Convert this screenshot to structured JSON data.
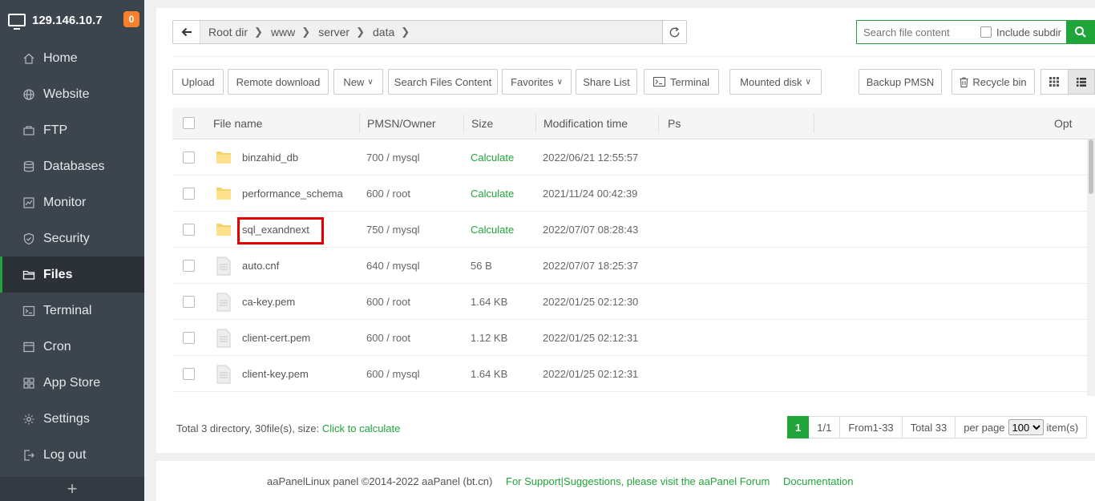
{
  "sidebar": {
    "server_ip": "129.146.10.7",
    "notification_count": "0",
    "items": [
      {
        "label": "Home",
        "icon": "home-icon"
      },
      {
        "label": "Website",
        "icon": "globe-icon"
      },
      {
        "label": "FTP",
        "icon": "ftp-icon"
      },
      {
        "label": "Databases",
        "icon": "database-icon"
      },
      {
        "label": "Monitor",
        "icon": "monitor-icon"
      },
      {
        "label": "Security",
        "icon": "shield-icon"
      },
      {
        "label": "Files",
        "icon": "folder-icon",
        "active": true
      },
      {
        "label": "Terminal",
        "icon": "terminal-icon"
      },
      {
        "label": "Cron",
        "icon": "clock-icon"
      },
      {
        "label": "App Store",
        "icon": "grid-icon"
      },
      {
        "label": "Settings",
        "icon": "gear-icon"
      },
      {
        "label": "Log out",
        "icon": "logout-icon"
      }
    ],
    "add_label": "+"
  },
  "path": {
    "crumbs": [
      "Root dir",
      "www",
      "server",
      "data"
    ]
  },
  "search": {
    "placeholder": "Search file content",
    "include_subdir_label": "Include subdir"
  },
  "toolbar": {
    "upload": "Upload",
    "remote_download": "Remote download",
    "new": "New",
    "search_files_content": "Search Files Content",
    "favorites": "Favorites",
    "share_list": "Share List",
    "terminal": "Terminal",
    "mounted_disk": "Mounted disk",
    "backup_pmsn": "Backup PMSN",
    "recycle_bin": "Recycle bin"
  },
  "table": {
    "headers": {
      "name": "File name",
      "pmsn": "PMSN/Owner",
      "size": "Size",
      "mtime": "Modification time",
      "ps": "Ps",
      "opt": "Opt"
    },
    "rows": [
      {
        "name": "binzahid_db",
        "type": "folder",
        "pmsn": "700 / mysql",
        "size": "Calculate",
        "mtime": "2022/06/21 12:55:57"
      },
      {
        "name": "performance_schema",
        "type": "folder",
        "pmsn": "600 / root",
        "size": "Calculate",
        "mtime": "2021/11/24 00:42:39"
      },
      {
        "name": "sql_exandnext",
        "type": "folder",
        "pmsn": "750 / mysql",
        "size": "Calculate",
        "mtime": "2022/07/07 08:28:43",
        "highlighted": true
      },
      {
        "name": "auto.cnf",
        "type": "file",
        "pmsn": "640 / mysql",
        "size": "56 B",
        "mtime": "2022/07/07 18:25:37"
      },
      {
        "name": "ca-key.pem",
        "type": "file",
        "pmsn": "600 / root",
        "size": "1.64 KB",
        "mtime": "2022/01/25 02:12:30"
      },
      {
        "name": "client-cert.pem",
        "type": "file",
        "pmsn": "600 / root",
        "size": "1.12 KB",
        "mtime": "2022/01/25 02:12:31"
      },
      {
        "name": "client-key.pem",
        "type": "file",
        "pmsn": "600 / mysql",
        "size": "1.64 KB",
        "mtime": "2022/01/25 02:12:31"
      }
    ]
  },
  "summary": {
    "text": "Total 3 directory, 30file(s), size:",
    "link": "Click to calculate"
  },
  "pager": {
    "current": "1",
    "pages": "1/1",
    "range": "From1-33",
    "total": "Total 33",
    "per_page_label": "per page",
    "per_page_value": "100",
    "items_label": "item(s)"
  },
  "footer": {
    "copyright": "aaPanelLinux panel ©2014-2022 aaPanel (bt.cn)",
    "support": "For Support|Suggestions, please visit the aaPanel Forum",
    "docs": "Documentation"
  },
  "colors": {
    "accent": "#20a53a",
    "sidebar_bg": "#3c444d",
    "badge": "#f7812c",
    "highlight": "#e40000"
  }
}
